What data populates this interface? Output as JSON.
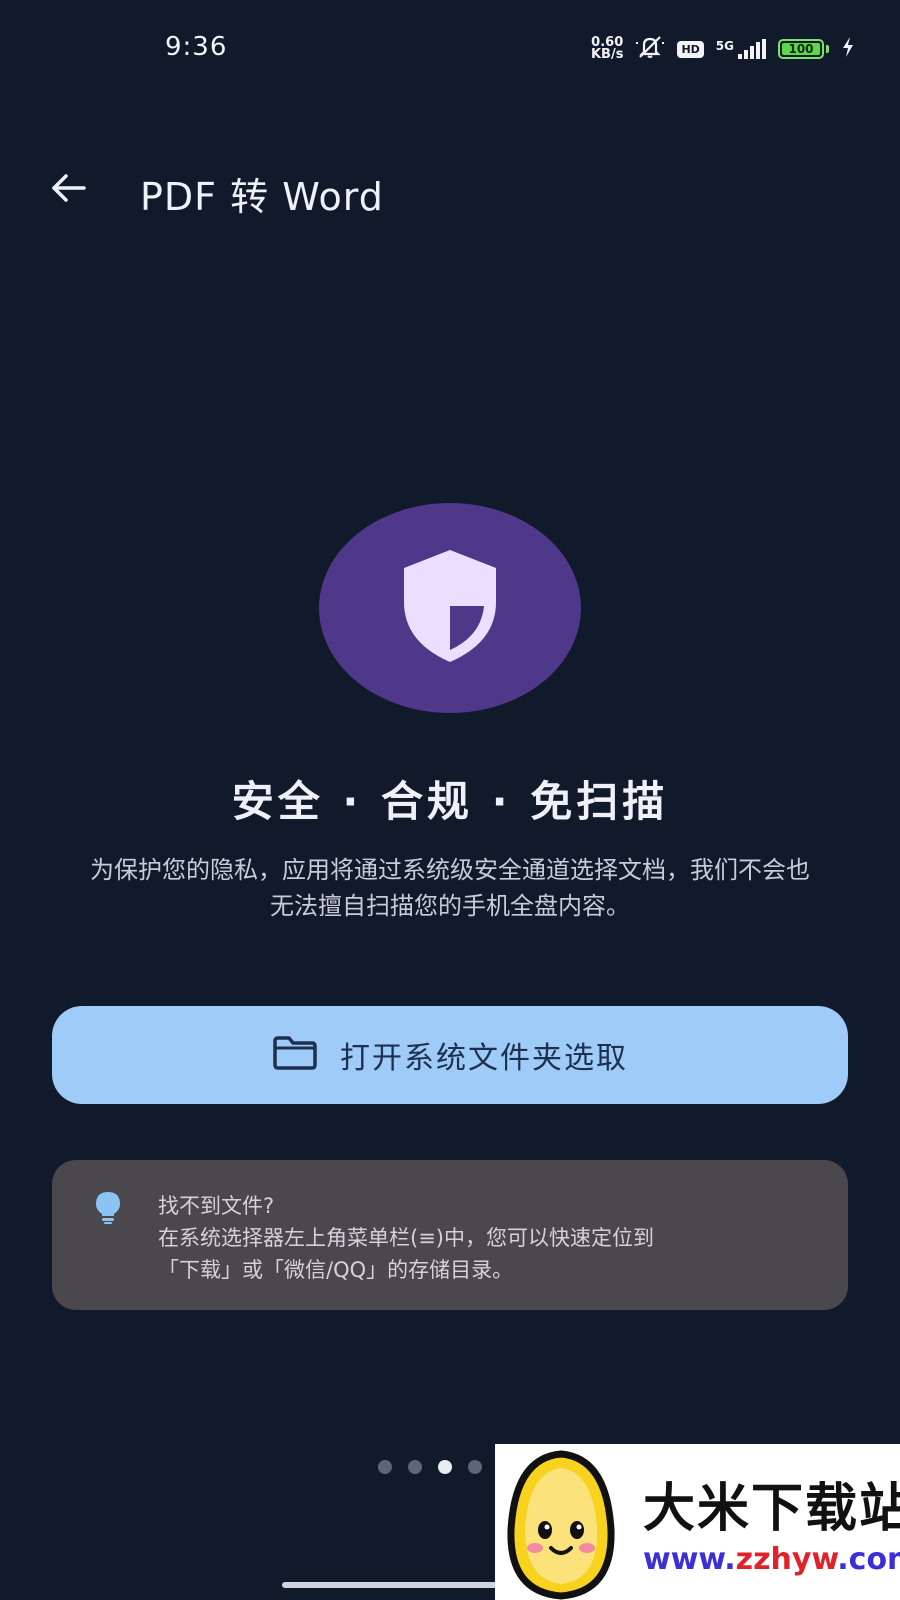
{
  "status_bar": {
    "time": "9:36",
    "net_speed_value": "0.60",
    "net_speed_unit": "KB/s",
    "hd_label": "HD",
    "network_label": "5G",
    "battery_level": "100",
    "battery_fraction": 1.0,
    "icons": [
      "mute-bell-icon",
      "hd-icon",
      "signal-icon",
      "battery-icon",
      "charging-icon"
    ]
  },
  "app_bar": {
    "back_icon": "arrow-left-icon",
    "title": "PDF 转 Word"
  },
  "hero": {
    "icon": "shield-icon",
    "headline": "安全 · 合规 · 免扫描",
    "description": "为保护您的隐私，应用将通过系统级安全通道选择文档，我们不会也无法擅自扫描您的手机全盘内容。"
  },
  "primary_button": {
    "icon": "folder-icon",
    "label": "打开系统文件夹选取"
  },
  "tip": {
    "icon": "lightbulb-icon",
    "title": "找不到文件?",
    "line1": "在系统选择器左上角菜单栏(≡)中，您可以快速定位到",
    "line2": "「下载」或「微信/QQ」的存储目录。"
  },
  "pager": {
    "count": 4,
    "active_index": 2
  },
  "watermark": {
    "name": "大米下载站",
    "url_prefix": "www.",
    "url_domain": "zzhyw",
    "url_suffix": ".com"
  },
  "colors": {
    "background": "#111a2b",
    "hero_circle": "#4f378a",
    "shield": "#eadfff",
    "primary_button": "#9ecbf7",
    "primary_button_text": "#1f2f4f",
    "tip_card": "#4a474d",
    "tip_icon": "#8cc3f5",
    "battery": "#5cd64a"
  }
}
